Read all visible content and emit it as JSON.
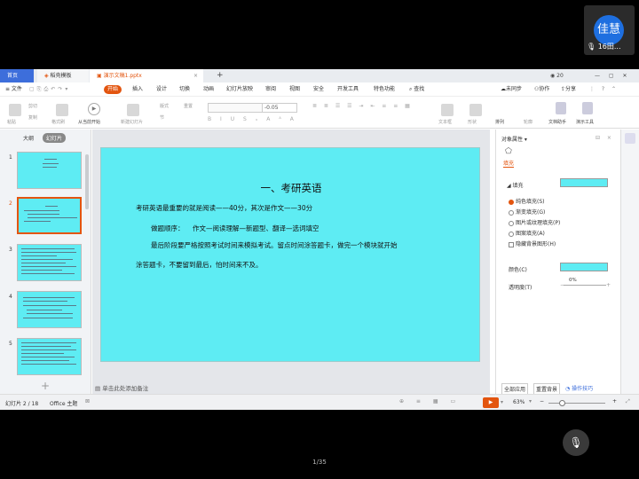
{
  "meeting": {
    "avatar_text": "佳慧",
    "name": "16田...",
    "page_indicator": "1/35"
  },
  "tabs": {
    "home": "首页",
    "template": "稻壳模板",
    "doc": "演示文稿1.pptx",
    "add": "+",
    "user_count": "20"
  },
  "menu": {
    "file": "≡ 文件",
    "items": [
      "开始",
      "插入",
      "设计",
      "切换",
      "动画",
      "幻灯片放映",
      "审阅",
      "视图",
      "安全",
      "开发工具",
      "特色功能"
    ],
    "search": "查找",
    "sync": "未同步",
    "collab": "协作",
    "share": "分享"
  },
  "toolbar": {
    "paste": "粘贴",
    "cut": "剪切",
    "copy": "复制",
    "format_painter": "格式刷",
    "play_from_current": "从当前开始",
    "new_slide": "新建幻灯片",
    "layout": "版式",
    "section": "节",
    "reset": "重置",
    "size_value": "-0.05",
    "text_box": "文本框",
    "shape": "形状",
    "arrange": "排列",
    "outline": "轮廓",
    "doc_assistant": "文档助手",
    "present_tool": "演示工具"
  },
  "leftpane": {
    "tabs": [
      "大纲",
      "幻灯片"
    ],
    "thumbs": [
      {
        "num": "1"
      },
      {
        "num": "2"
      },
      {
        "num": "3"
      },
      {
        "num": "4"
      },
      {
        "num": "5"
      }
    ],
    "add": "+"
  },
  "slide": {
    "title": "一、考研英语",
    "lines": [
      "考研英语最重要的就是阅读——40分，其次是作文——30分",
      "做题顺序：    作文—阅读理解—新题型、翻译—选词填空",
      "最后阶段要严格按照考试时间来模拟考试。留点时间涂答题卡，做完一个模块就开始",
      "涂答题卡，不要留到最后，怕时间来不及。"
    ],
    "notes_placeholder": "单击此处添加备注"
  },
  "rightpane": {
    "title": "对象属性 ▾",
    "fill_tab": "填充",
    "fill_section": "◢ 填充",
    "options": [
      "纯色填充(S)",
      "渐变填充(G)",
      "图片或纹理填充(P)",
      "图案填充(A)"
    ],
    "hide_bg": "隐藏背景图形(H)",
    "color_label": "颜色(C)",
    "transparency_label": "透明度(T)",
    "transparency_value": "0%",
    "apply_all": "全部应用",
    "reset_bg": "重置背景",
    "tips": "操作技巧"
  },
  "status": {
    "slide_info": "幻灯片 2 / 18",
    "theme": "Office 主题",
    "zoom": "63%",
    "zoom_minus": "−",
    "zoom_plus": "+"
  },
  "colors": {
    "accent": "#e3550f",
    "slide_bg": "#5eecf3",
    "home_tab": "#3d6edb"
  }
}
